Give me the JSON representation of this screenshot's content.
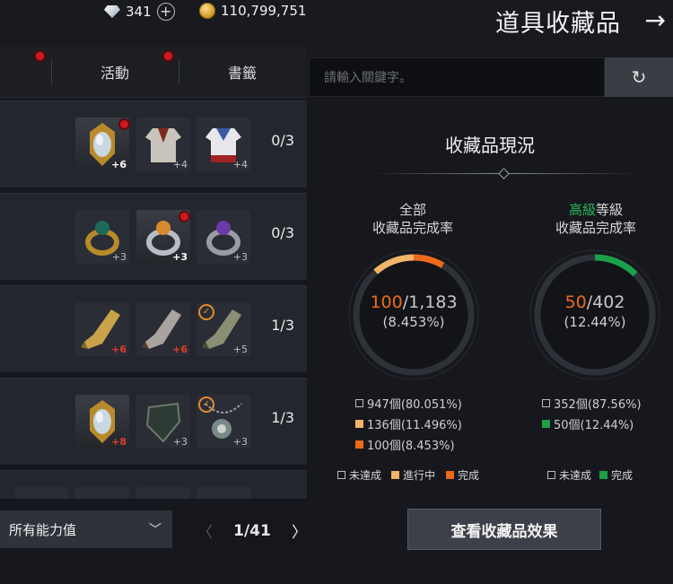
{
  "header": {
    "diamonds": "341",
    "gold": "110,799,751",
    "title": "道具收藏品"
  },
  "tabs": [
    {
      "label": "活動"
    },
    {
      "label": "書籤"
    }
  ],
  "rows": [
    {
      "progress": "0/3",
      "items": [
        {
          "icon": "mirror-amulet",
          "level": "+6",
          "level_style": "white",
          "badge": "red-dot"
        },
        {
          "icon": "robe",
          "level": "+4",
          "level_style": "gray"
        },
        {
          "icon": "sailor-tunic",
          "level": "+4",
          "level_style": "gray"
        }
      ]
    },
    {
      "progress": "0/3",
      "items": [
        {
          "icon": "emerald-ring",
          "level": "+3",
          "level_style": "gray"
        },
        {
          "icon": "amber-ring",
          "level": "+3",
          "level_style": "white",
          "badge": "red-dot"
        },
        {
          "icon": "amethyst-ring",
          "level": "+3",
          "level_style": "gray"
        }
      ]
    },
    {
      "progress": "1/3",
      "items": [
        {
          "icon": "gold-gauntlet",
          "level": "+6",
          "level_style": "red"
        },
        {
          "icon": "steel-gauntlet",
          "level": "+6",
          "level_style": "red"
        },
        {
          "icon": "green-gauntlet",
          "level": "+5",
          "level_style": "gray",
          "badge": "check"
        }
      ]
    },
    {
      "progress": "1/3",
      "items": [
        {
          "icon": "mirror-amulet",
          "level": "+8",
          "level_style": "red"
        },
        {
          "icon": "dark-shield",
          "level": "+3",
          "level_style": "gray"
        },
        {
          "icon": "chain-pendant",
          "level": "+3",
          "level_style": "gray",
          "badge": "check"
        }
      ]
    }
  ],
  "footer": {
    "filter_label": "所有能力值",
    "page": "1/41"
  },
  "search": {
    "placeholder": "請輸入關鍵字。"
  },
  "status": {
    "title": "收藏品現況",
    "all": {
      "head_line1": "全部",
      "head_line2": "收藏品完成率",
      "done": "100",
      "total": "/1,183",
      "percent": "(8.453%)",
      "fraction_in_progress": 0.11496,
      "fraction_done": 0.08453,
      "legend": [
        {
          "text": "947個(80.051%)",
          "key": "empty"
        },
        {
          "text": "136個(11.496%)",
          "key": "orange-light"
        },
        {
          "text": "100個(8.453%)",
          "key": "orange"
        }
      ],
      "keys": [
        "未達成",
        "進行中",
        "完成"
      ]
    },
    "advanced": {
      "head_highlight": "高級",
      "head_line1_rest": "等級",
      "head_line2": "收藏品完成率",
      "done": "50",
      "total": "/402",
      "percent": "(12.44%)",
      "fraction_done": 0.1244,
      "legend": [
        {
          "text": "352個(87.56%)",
          "key": "empty"
        },
        {
          "text": "50個(12.44%)",
          "key": "green"
        }
      ],
      "keys": [
        "未達成",
        "完成"
      ]
    }
  },
  "effects_button": "查看收藏品效果",
  "colors": {
    "orange": "#ee6a1a",
    "orange_light": "#f2b46a",
    "green": "#1aa14a",
    "gold": "#d59a22"
  }
}
